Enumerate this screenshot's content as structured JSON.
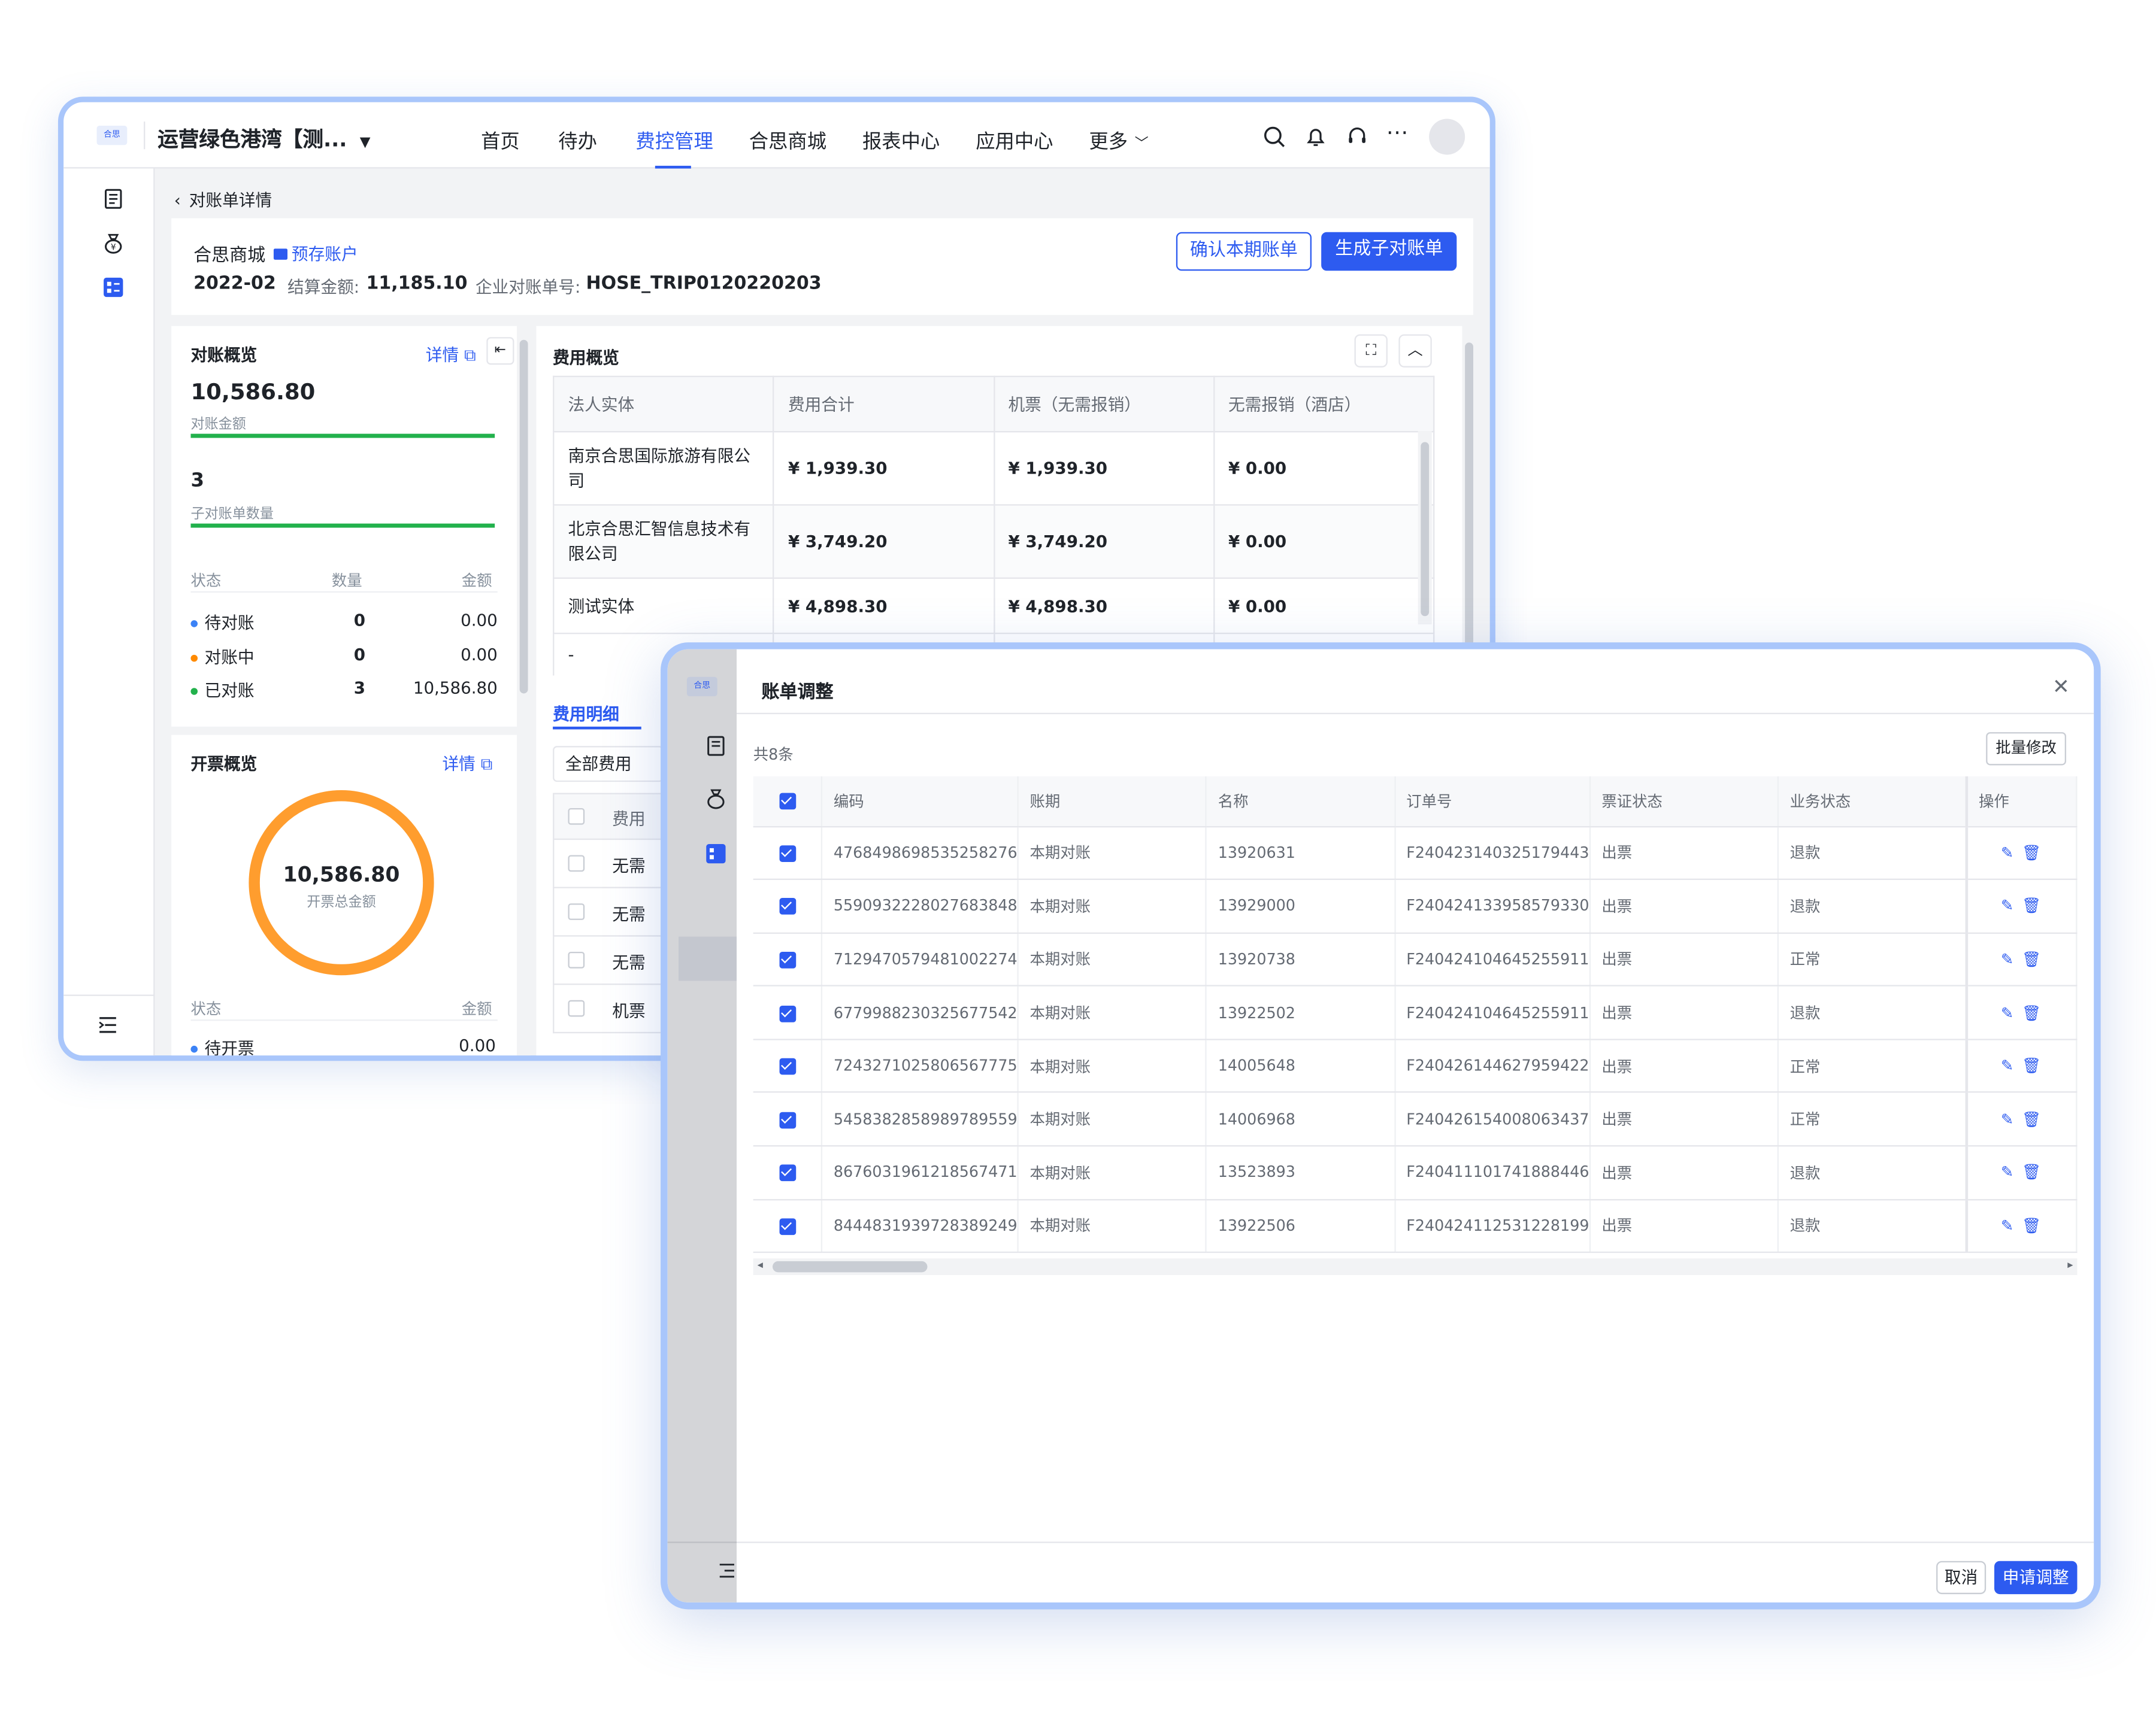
{
  "app": {
    "title": "运营绿色港湾【测...",
    "logo_text": "合思"
  },
  "nav": {
    "items": [
      "首页",
      "待办",
      "费控管理",
      "合思商城",
      "报表中心",
      "应用中心",
      "更多"
    ]
  },
  "breadcrumb": {
    "label": "对账单详情"
  },
  "header": {
    "vendor": "合思商城",
    "account_tag": "预存账户",
    "period": "2022-02",
    "settle_label": "结算金额:",
    "settle_value": "11,185.10",
    "bill_no_label": "企业对账单号:",
    "bill_no": "HOSE_TRIP0120220203",
    "confirm_button": "确认本期账单",
    "generate_button": "生成子对账单"
  },
  "recon": {
    "title": "对账概览",
    "detail_link": "详情",
    "amount": "10,586.80",
    "amount_label": "对账金额",
    "amount_progress": 1.0,
    "count": "3",
    "count_label": "子对账单数量",
    "count_progress": 1.0,
    "col_status": "状态",
    "col_count": "数量",
    "col_amount": "金额",
    "rows": [
      {
        "status": "待对账",
        "count": "0",
        "amount": "0.00",
        "color": "#3b82f6"
      },
      {
        "status": "对账中",
        "count": "0",
        "amount": "0.00",
        "color": "#ff8a00"
      },
      {
        "status": "已对账",
        "count": "3",
        "amount": "10,586.80",
        "color": "#22b14c"
      }
    ]
  },
  "invoice": {
    "title": "开票概览",
    "detail_link": "详情",
    "total": "10,586.80",
    "total_label": "开票总金额",
    "col_status": "状态",
    "col_amount": "金额",
    "rows": [
      {
        "status": "待开票",
        "amount": "0.00",
        "color": "#3b82f6"
      }
    ]
  },
  "expense": {
    "title": "费用概览",
    "headers": [
      "法人实体",
      "费用合计",
      "机票（无需报销）",
      "无需报销（酒店）"
    ],
    "rows": [
      [
        "南京合思国际旅游有限公司",
        "¥ 1,939.30",
        "¥ 1,939.30",
        "¥ 0.00"
      ],
      [
        "北京合思汇智信息技术有限公司",
        "¥ 3,749.20",
        "¥ 3,749.20",
        "¥ 0.00"
      ],
      [
        "测试实体",
        "¥ 4,898.30",
        "¥ 4,898.30",
        "¥ 0.00"
      ]
    ],
    "partial_row": "-",
    "detail_tab": "费用明细",
    "filter": "全部费用",
    "detail_col": "费用",
    "detail_rows": [
      "无需",
      "无需",
      "无需",
      "机票"
    ]
  },
  "modal": {
    "title": "账单调整",
    "total": "共8条",
    "batch_button": "批量修改",
    "headers": [
      "编码",
      "账期",
      "名称",
      "订单号",
      "票证状态",
      "业务状态",
      "操作"
    ],
    "rows": [
      [
        "4768498698535258276",
        "本期对账",
        "13920631",
        "F240423140325179443",
        "出票",
        "退款"
      ],
      [
        "5590932228027683848",
        "本期对账",
        "13929000",
        "F240424133958579330",
        "出票",
        "退款"
      ],
      [
        "7129470579481002274",
        "本期对账",
        "13920738",
        "F240424104645255911",
        "出票",
        "正常"
      ],
      [
        "6779988230325677542",
        "本期对账",
        "13922502",
        "F240424104645255911",
        "出票",
        "退款"
      ],
      [
        "7243271025806567775",
        "本期对账",
        "14005648",
        "F240426144627959422",
        "出票",
        "正常"
      ],
      [
        "5458382858989789559",
        "本期对账",
        "14006968",
        "F240426154008063437",
        "出票",
        "正常"
      ],
      [
        "8676031961218567471",
        "本期对账",
        "13523893",
        "F240411101741888446",
        "出票",
        "退款"
      ],
      [
        "8444831939728389249",
        "本期对账",
        "13922506",
        "F240424112531228199",
        "出票",
        "退款"
      ]
    ],
    "cancel_button": "取消",
    "submit_button": "申请调整"
  },
  "colors": {
    "accent": "#2d5bf0",
    "green": "#22b14c",
    "orange": "#ff9d2e",
    "frame": "#a9c6fb"
  }
}
